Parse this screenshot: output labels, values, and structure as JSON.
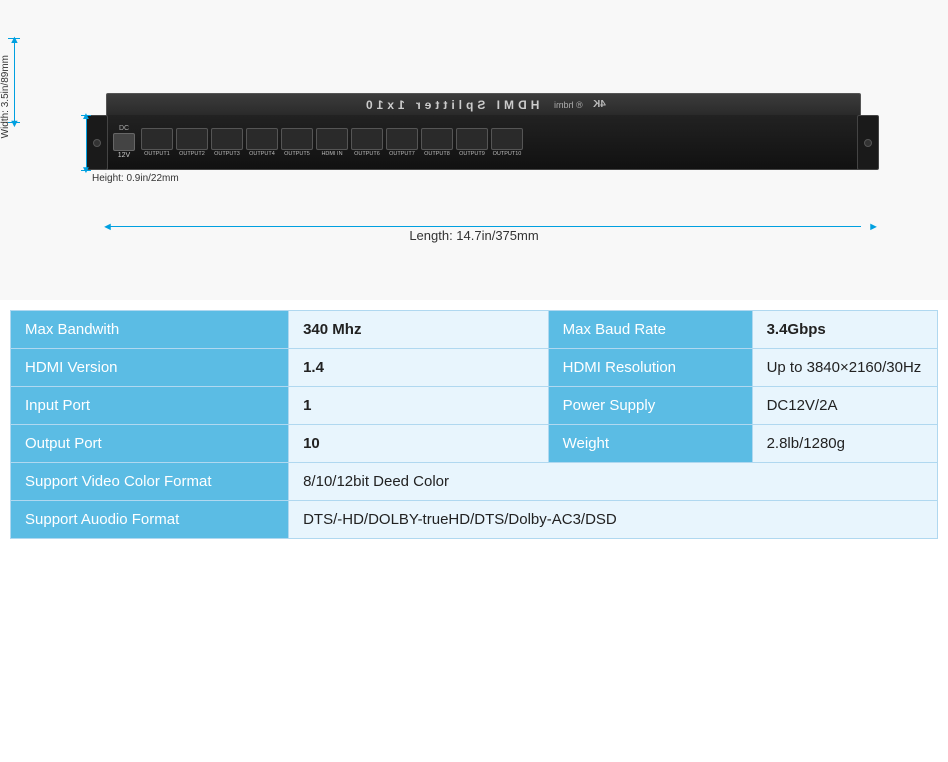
{
  "product": {
    "title": "HDMI Splitter 1x10",
    "subtitle": "4K",
    "brand": "hdmi",
    "dimension_width": "Width: 3.5in/89mm",
    "dimension_height": "Height: 0.9in/22mm",
    "dimension_length": "Length: 14.7in/375mm"
  },
  "ports": {
    "dc_label": "DC",
    "dc_voltage": "12V",
    "outputs": [
      "OUTPUT1",
      "OUTPUT2",
      "OUTPUT3",
      "OUTPUT4",
      "OUTPUT5",
      "HDMI IN",
      "OUTPUT6",
      "OUTPUT7",
      "OUTPUT8",
      "OUTPUT9",
      "OUTPUT10"
    ]
  },
  "specs": {
    "rows": [
      {
        "label1": "Max Bandwith",
        "value1": "340 Mhz",
        "label2": "Max Baud Rate",
        "value2": "3.4Gbps"
      },
      {
        "label1": "HDMI Version",
        "value1": "1.4",
        "label2": "HDMI Resolution",
        "value2": "Up to 3840×2160/30Hz"
      },
      {
        "label1": "Input Port",
        "value1": "1",
        "label2": "Power Supply",
        "value2": "DC12V/2A"
      },
      {
        "label1": "Output Port",
        "value1": "10",
        "label2": "Weight",
        "value2": "2.8lb/1280g"
      }
    ],
    "full_rows": [
      {
        "label": "Support Video Color Format",
        "value": "8/10/12bit Deed Color"
      },
      {
        "label": "Support  Auodio  Format",
        "value": "DTS/-HD/DOLBY-trueHD/DTS/Dolby-AC3/DSD"
      }
    ]
  }
}
